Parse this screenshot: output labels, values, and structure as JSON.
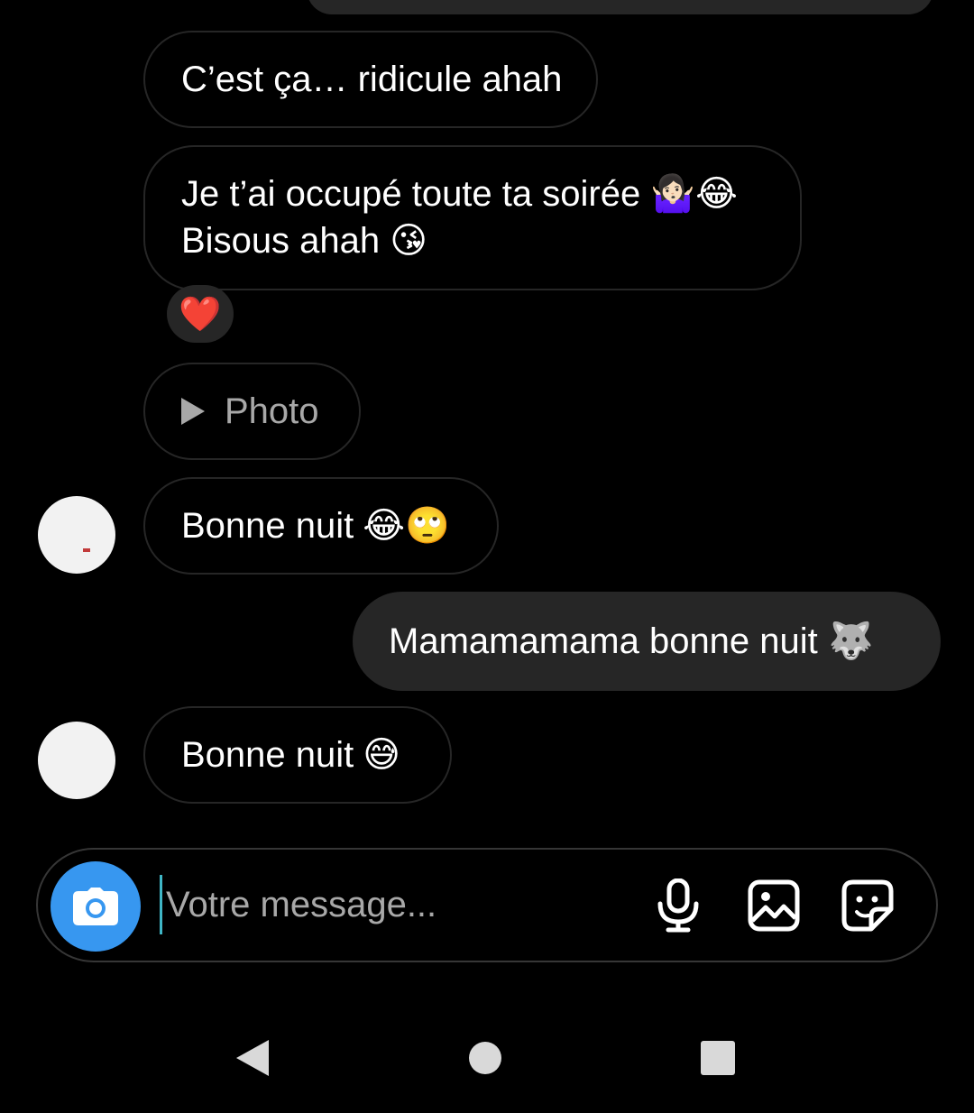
{
  "messages": [
    {
      "text": "C’est ça… ridicule ahah"
    },
    {
      "line1": "Je t’ai occupé toute ta soirée",
      "line1_emoji": "🤷🏻‍♀️😂",
      "line2": "Bisous ahah",
      "line2_emoji": "😘",
      "reaction": "❤️"
    },
    {
      "label": "Photo",
      "icon": "play-icon"
    },
    {
      "text": "Bonne nuit",
      "emoji": "😂🙄"
    },
    {
      "text": "Mamamamama bonne nuit",
      "emoji": "🐺"
    },
    {
      "text": "Bonne nuit",
      "emoji": "😅"
    }
  ],
  "composer": {
    "placeholder": "Votre message...",
    "icons": [
      "camera-icon",
      "microphone-icon",
      "gallery-icon",
      "sticker-icon"
    ]
  },
  "navbar": {
    "icons": [
      "back-icon",
      "home-icon",
      "recents-icon"
    ]
  },
  "colors": {
    "background": "#000000",
    "bubble_sent": "#262626",
    "bubble_border": "#262626",
    "accent": "#3797f0",
    "muted_text": "#a8a8a8"
  }
}
